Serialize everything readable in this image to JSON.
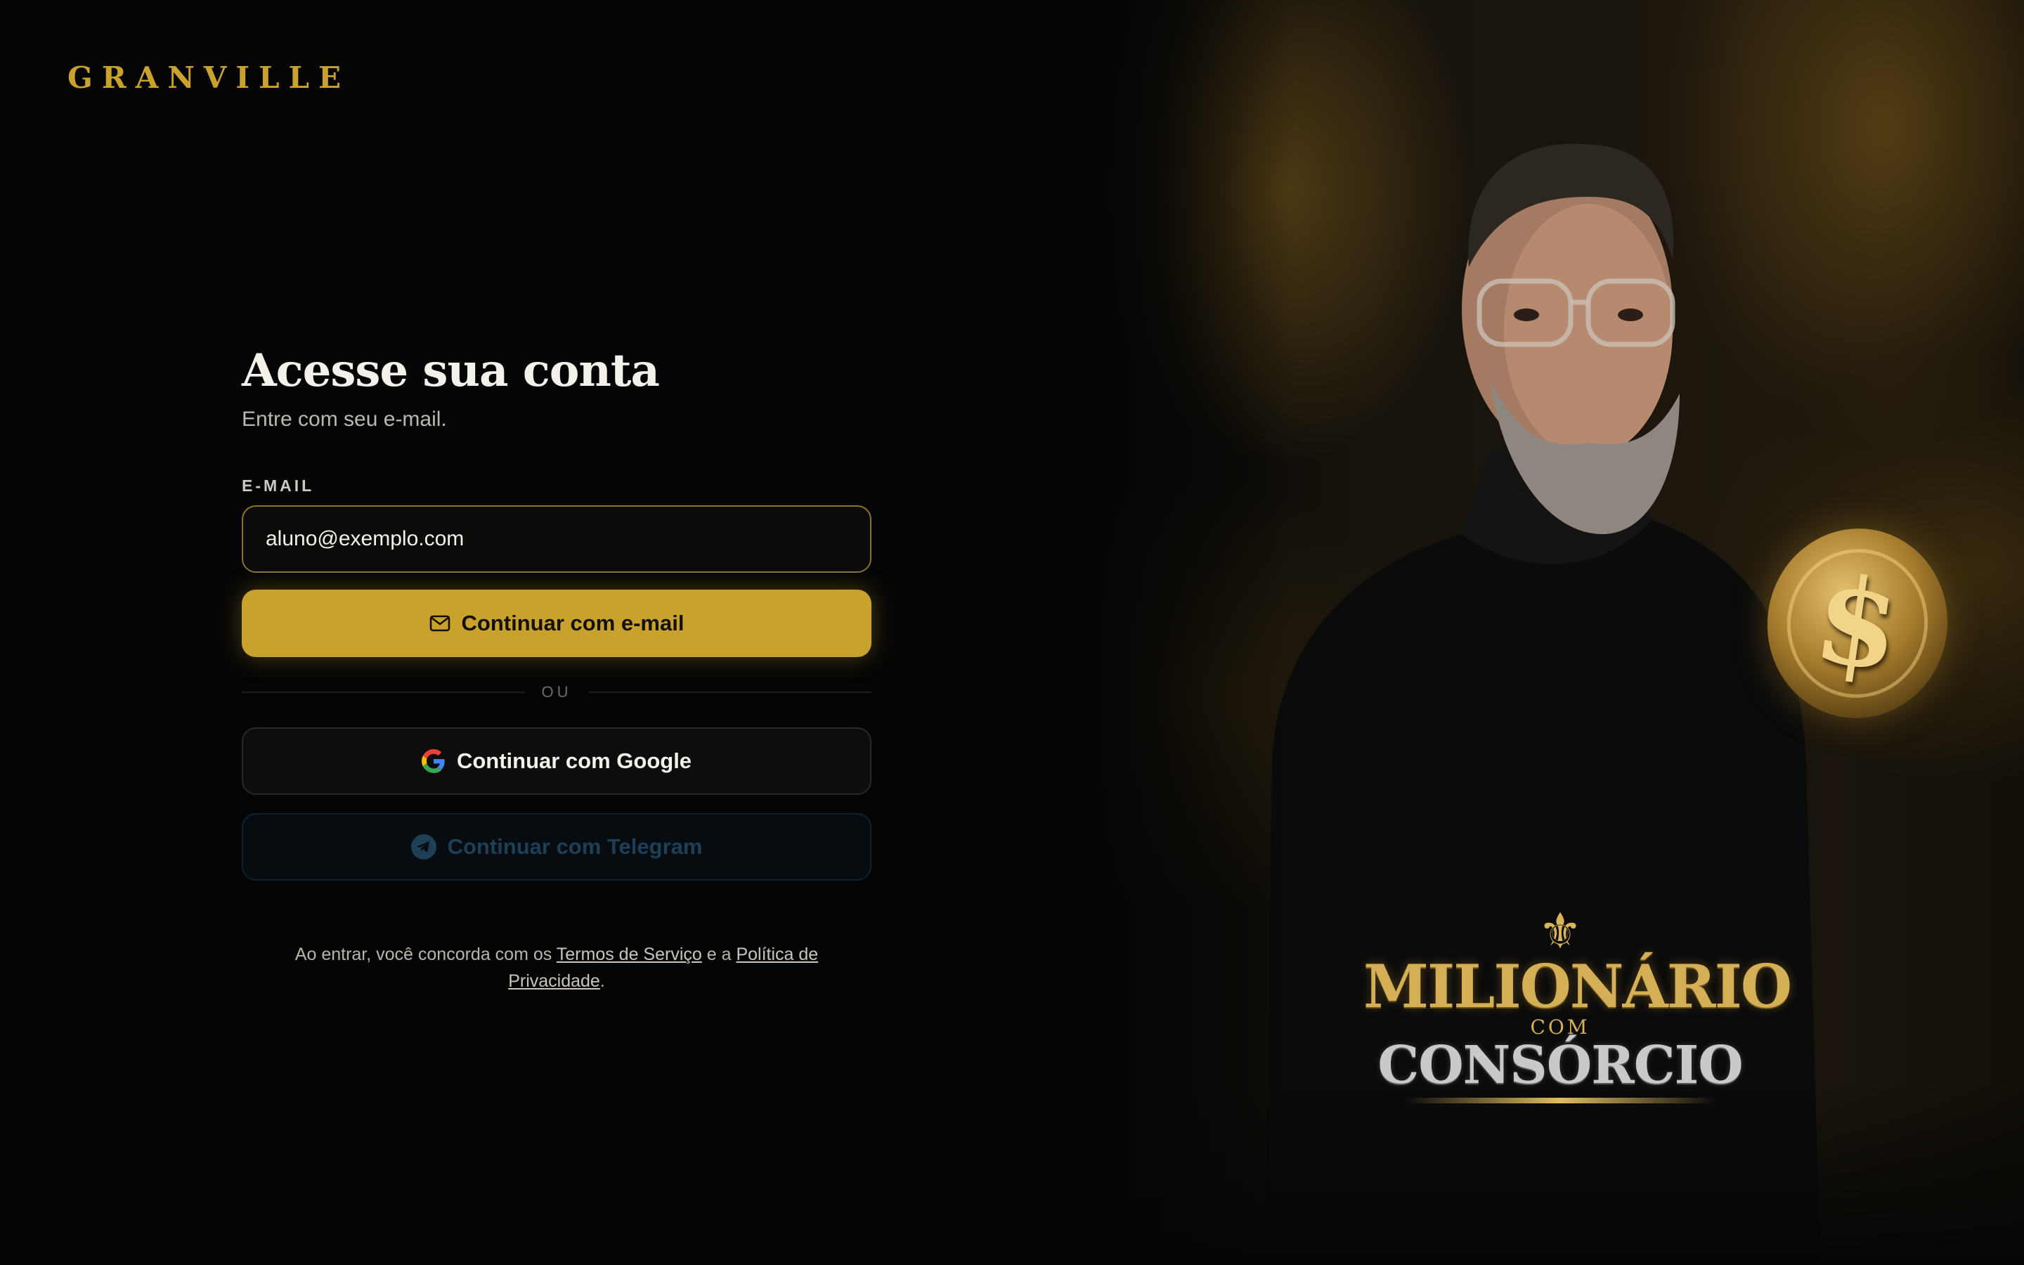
{
  "brand": {
    "name": "GRANVILLE"
  },
  "login": {
    "title": "Acesse sua conta",
    "subtitle": "Entre com seu e-mail.",
    "email_label": "E-MAIL",
    "email_value": "aluno@exemplo.com",
    "email_button": "Continuar com e-mail",
    "divider": "OU",
    "google_button": "Continuar com Google",
    "telegram_button": "Continuar com Telegram",
    "legal_prefix": "Ao entrar, você concorda com os ",
    "terms_link": "Termos de Serviço",
    "legal_middle": " e a ",
    "privacy_link": "Política de Privacidade",
    "legal_suffix": "."
  },
  "hero": {
    "logo_line1": "MILIONÁRIO",
    "logo_line2": "COM",
    "logo_line3": "CONSÓRCIO",
    "coin_symbol": "$"
  },
  "icons": {
    "email": "mail-icon",
    "google": "google-icon",
    "telegram": "telegram-icon"
  },
  "colors": {
    "accent": "#c9a22e",
    "background": "#050505",
    "telegram": "#1f3f57"
  }
}
